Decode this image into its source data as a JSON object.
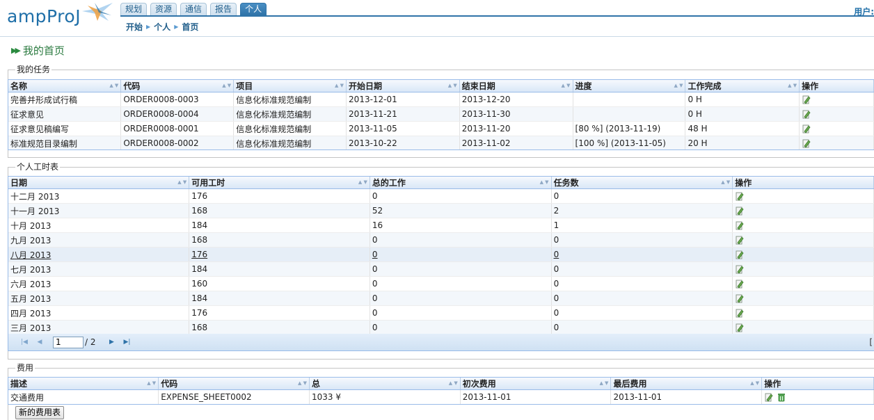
{
  "header": {
    "logo": "ampProJ",
    "tabs": [
      {
        "label": "规划",
        "active": false
      },
      {
        "label": "资源",
        "active": false
      },
      {
        "label": "通信",
        "active": false
      },
      {
        "label": "报告",
        "active": false
      },
      {
        "label": "个人",
        "active": true
      }
    ],
    "breadcrumb": [
      "开始",
      "个人",
      "首页"
    ],
    "user_label": "用户: "
  },
  "page_title": "我的首页",
  "tasks": {
    "legend": "我的任务",
    "columns": [
      "名称",
      "代码",
      "项目",
      "开始日期",
      "结束日期",
      "进度",
      "工作完成",
      "操作"
    ],
    "rows": [
      {
        "name": "完善并形成试行稿",
        "code": "ORDER0008-0003",
        "project": "信息化标准规范编制",
        "start": "2013-12-01",
        "end": "2013-12-20",
        "progress": "",
        "work": "0 H"
      },
      {
        "name": "征求意见",
        "code": "ORDER0008-0004",
        "project": "信息化标准规范编制",
        "start": "2013-11-21",
        "end": "2013-11-30",
        "progress": "",
        "work": "0 H"
      },
      {
        "name": "征求意见稿编写",
        "code": "ORDER0008-0001",
        "project": "信息化标准规范编制",
        "start": "2013-11-05",
        "end": "2013-11-20",
        "progress": "[80 %] (2013-11-19)",
        "work": "48 H"
      },
      {
        "name": "标准规范目录编制",
        "code": "ORDER0008-0002",
        "project": "信息化标准规范编制",
        "start": "2013-10-22",
        "end": "2013-11-02",
        "progress": "[100 %] (2013-11-05)",
        "work": "20 H"
      }
    ]
  },
  "timesheet": {
    "legend": "个人工时表",
    "columns": [
      "日期",
      "可用工时",
      "总的工作",
      "任务数",
      "操作"
    ],
    "rows": [
      {
        "date": "十二月 2013",
        "available": "176",
        "total": "0",
        "tasks": "0"
      },
      {
        "date": "十一月 2013",
        "available": "168",
        "total": "52",
        "tasks": "2"
      },
      {
        "date": "十月 2013",
        "available": "184",
        "total": "16",
        "tasks": "1"
      },
      {
        "date": "九月 2013",
        "available": "168",
        "total": "0",
        "tasks": "0"
      },
      {
        "date": "八月 2013",
        "available": "176",
        "total": "0",
        "tasks": "0"
      },
      {
        "date": "七月 2013",
        "available": "184",
        "total": "0",
        "tasks": "0"
      },
      {
        "date": "六月 2013",
        "available": "160",
        "total": "0",
        "tasks": "0"
      },
      {
        "date": "五月 2013",
        "available": "184",
        "total": "0",
        "tasks": "0"
      },
      {
        "date": "四月 2013",
        "available": "176",
        "total": "0",
        "tasks": "0"
      },
      {
        "date": "三月 2013",
        "available": "168",
        "total": "0",
        "tasks": "0"
      }
    ],
    "pager": {
      "page": "1",
      "total": "/ 2",
      "right": "["
    }
  },
  "expenses": {
    "legend": "费用",
    "columns": [
      "描述",
      "代码",
      "总",
      "初次费用",
      "最后费用",
      "操作"
    ],
    "rows": [
      {
        "desc": "交通费用",
        "code": "EXPENSE_SHEET0002",
        "total": "1033 ¥",
        "first": "2013-11-01",
        "last": "2013-11-01"
      }
    ],
    "new_button": "新的费用表"
  },
  "colors": {
    "accent": "#2f73a8",
    "title_green": "#2a7a3f",
    "grid_border": "#99bbe8"
  }
}
